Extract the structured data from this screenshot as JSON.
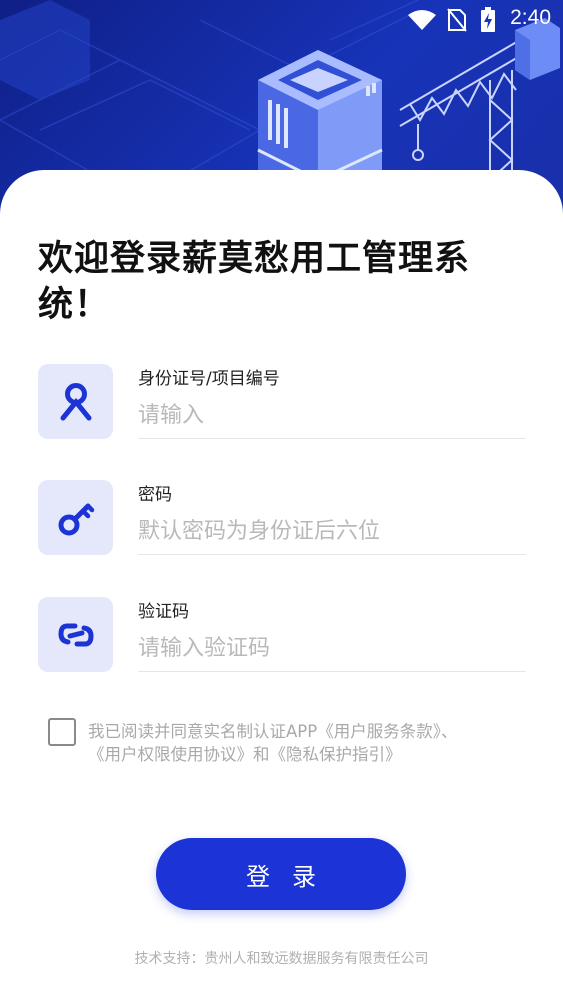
{
  "status_bar": {
    "time": "2:40",
    "icons": [
      "wifi-icon",
      "no-sim-icon",
      "battery-charging-icon"
    ]
  },
  "welcome_title": "欢迎登录薪莫愁用工管理系统！",
  "fields": [
    {
      "label": "身份证号/项目编号",
      "placeholder": "请输入",
      "value": "",
      "icon": "person-icon"
    },
    {
      "label": "密码",
      "placeholder": "默认密码为身份证后六位",
      "value": "",
      "icon": "key-icon"
    },
    {
      "label": "验证码",
      "placeholder": "请输入验证码",
      "value": "",
      "icon": "link-icon"
    }
  ],
  "agreement": {
    "checked": false,
    "text_prefix": "我已阅读并同意实名制认证APP",
    "terms": "《用户服务条款》",
    "sep": "、",
    "rights": "《用户权限使用协议》",
    "and": "和",
    "privacy": "《隐私保护指引》"
  },
  "login_button": "登录",
  "footer": "技术支持：贵州人和致远数据服务有限责任公司",
  "colors": {
    "primary": "#1c33d6",
    "icon_bg": "#e4e8fa",
    "header_bg": "#1733b8"
  }
}
